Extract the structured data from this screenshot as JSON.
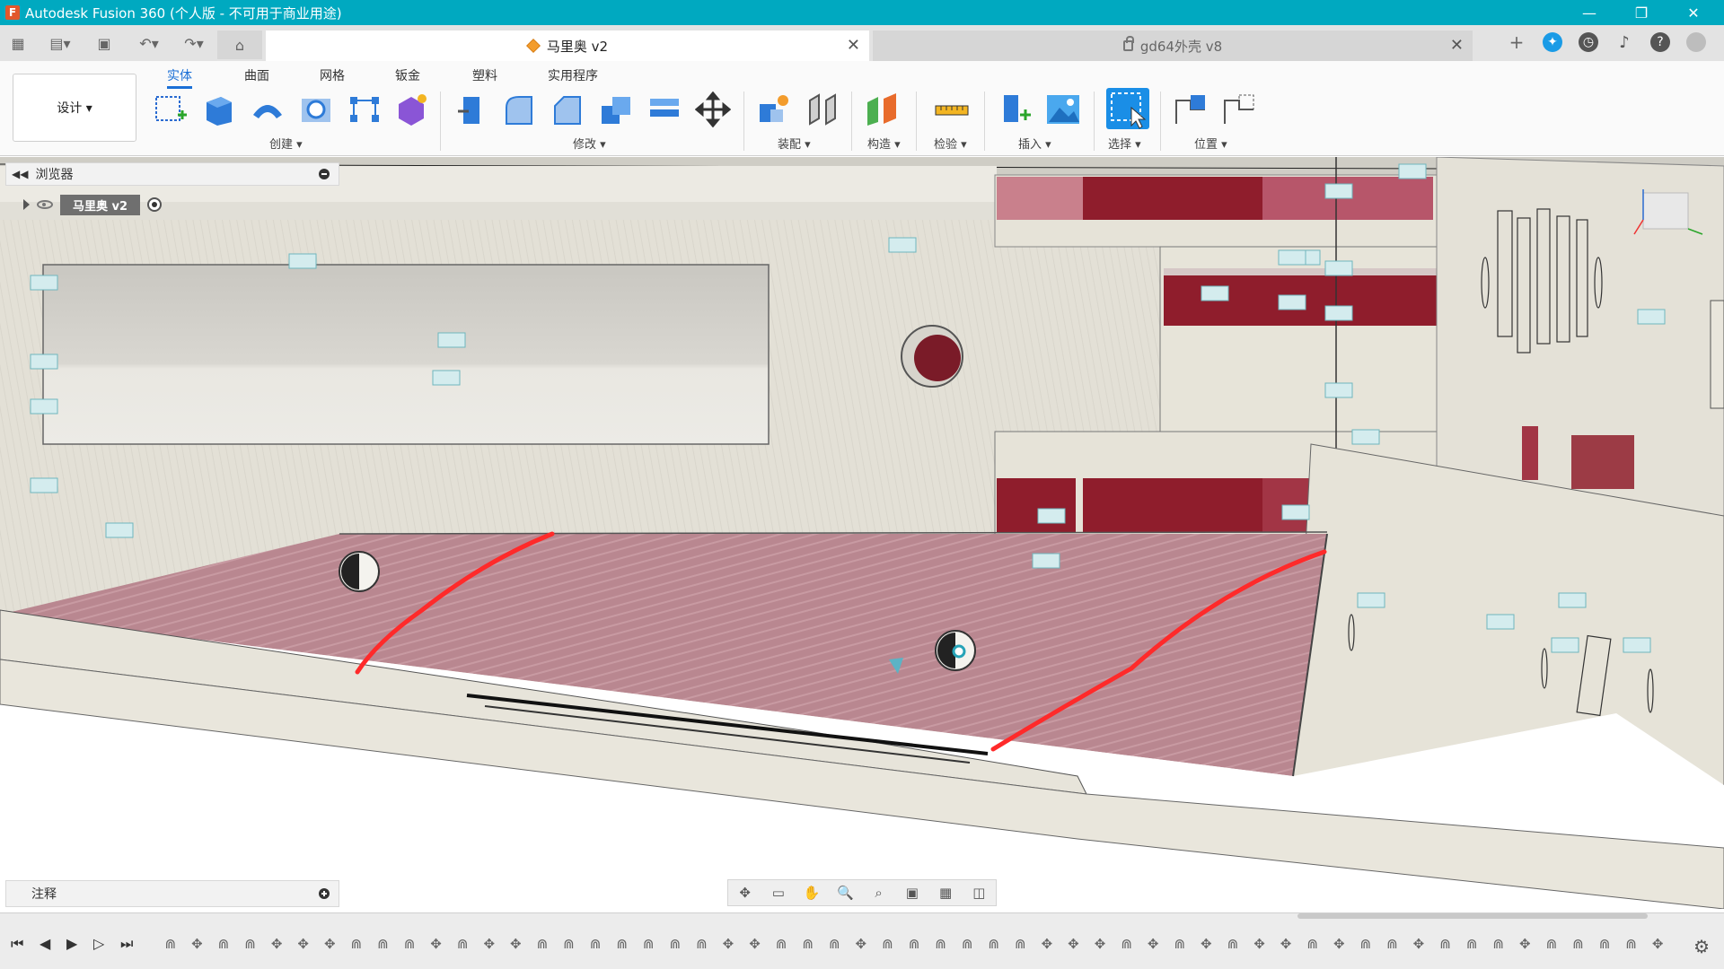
{
  "window": {
    "title": "Autodesk Fusion 360 (个人版 - 不可用于商业用途)",
    "controls": [
      "minimize",
      "restore",
      "close"
    ]
  },
  "tabs": {
    "active": {
      "label": "马里奥 v2"
    },
    "inactive": {
      "label": "gd64外壳 v8"
    }
  },
  "ribbon": {
    "workspace": "设计 ▾",
    "tabs": [
      "实体",
      "曲面",
      "网格",
      "钣金",
      "塑料",
      "实用程序"
    ],
    "active_tab": "实体",
    "groups": [
      "创建 ▾",
      "修改 ▾",
      "装配 ▾",
      "构造 ▾",
      "检验 ▾",
      "插入 ▾",
      "选择 ▾",
      "位置 ▾"
    ]
  },
  "browser": {
    "label": "浏览器",
    "root_node": "马里奥 v2"
  },
  "comments": {
    "label": "注释"
  },
  "colors": {
    "titlebar": "#00a9c0",
    "accent_blue": "#1a6fd6",
    "annotation_red": "#ff2a2a",
    "model_fill": "#e6e3d8",
    "model_red": "#9a1f2f"
  },
  "icons": {
    "navbar": [
      "orbit-icon",
      "look-at-icon",
      "pan-icon",
      "zoom-icon",
      "zoom-window-icon",
      "display-settings-icon",
      "grid-icon",
      "viewports-icon"
    ],
    "playback": [
      "first-icon",
      "previous-icon",
      "play-icon",
      "next-icon",
      "last-icon"
    ]
  }
}
